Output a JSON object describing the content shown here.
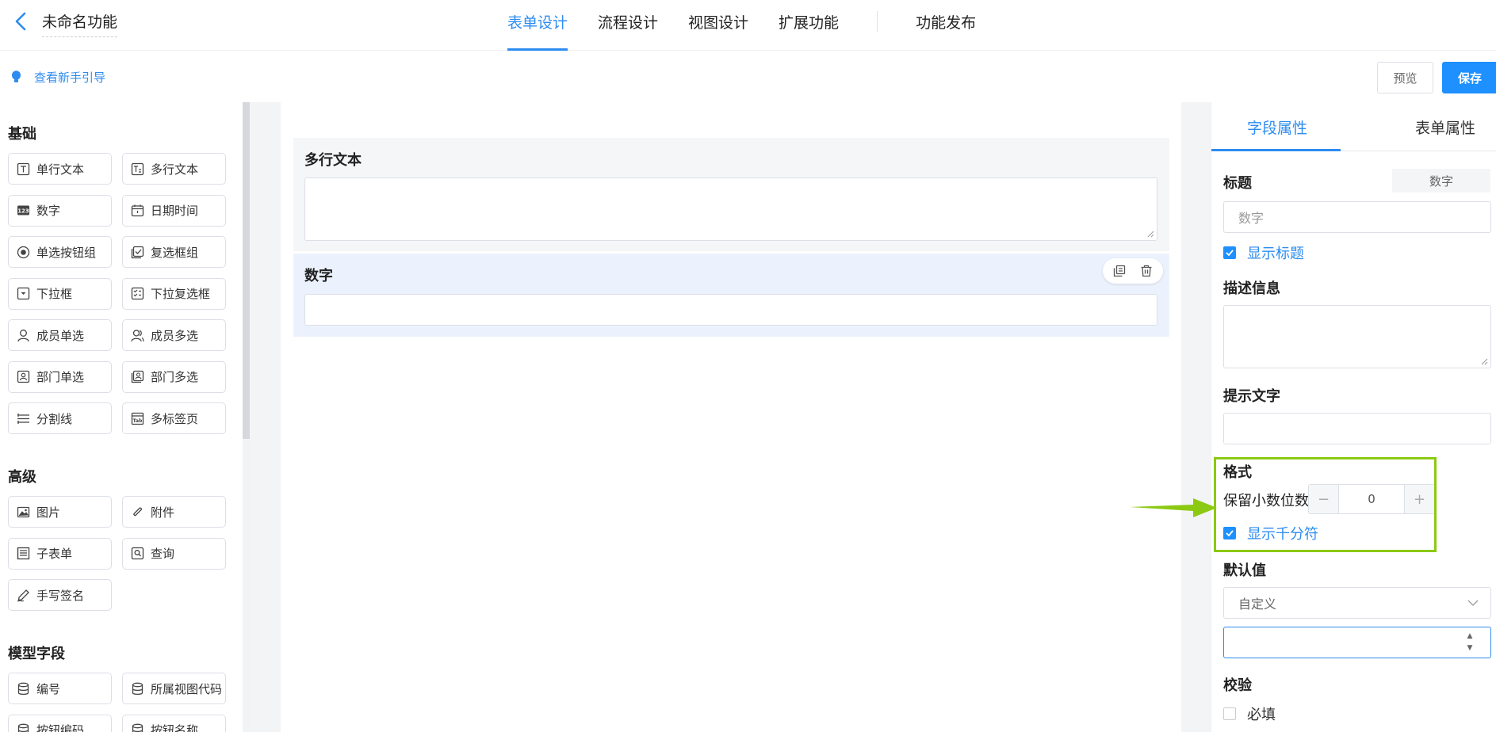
{
  "header": {
    "app_title": "未命名功能",
    "tabs": [
      {
        "label": "表单设计",
        "active": true
      },
      {
        "label": "流程设计",
        "active": false
      },
      {
        "label": "视图设计",
        "active": false
      },
      {
        "label": "扩展功能",
        "active": false
      },
      {
        "label": "功能发布",
        "active": false
      }
    ]
  },
  "subbar": {
    "guide_label": "查看新手引导",
    "preview_label": "预览",
    "save_label": "保存"
  },
  "palette": {
    "groups": [
      {
        "title": "基础",
        "items": [
          {
            "label": "单行文本",
            "icon": "single-line-text-icon"
          },
          {
            "label": "多行文本",
            "icon": "multi-line-text-icon"
          },
          {
            "label": "数字",
            "icon": "number-icon"
          },
          {
            "label": "日期时间",
            "icon": "calendar-icon"
          },
          {
            "label": "单选按钮组",
            "icon": "radio-icon"
          },
          {
            "label": "复选框组",
            "icon": "checkbox-icon"
          },
          {
            "label": "下拉框",
            "icon": "dropdown-icon"
          },
          {
            "label": "下拉复选框",
            "icon": "dropdown-checkbox-icon"
          },
          {
            "label": "成员单选",
            "icon": "user-icon"
          },
          {
            "label": "成员多选",
            "icon": "users-icon"
          },
          {
            "label": "部门单选",
            "icon": "department-icon"
          },
          {
            "label": "部门多选",
            "icon": "departments-icon"
          },
          {
            "label": "分割线",
            "icon": "divider-icon"
          },
          {
            "label": "多标签页",
            "icon": "tabs-icon"
          }
        ]
      },
      {
        "title": "高级",
        "items": [
          {
            "label": "图片",
            "icon": "image-icon"
          },
          {
            "label": "附件",
            "icon": "paperclip-icon"
          },
          {
            "label": "子表单",
            "icon": "subform-icon"
          },
          {
            "label": "查询",
            "icon": "query-icon"
          },
          {
            "label": "手写签名",
            "icon": "signature-icon"
          }
        ]
      },
      {
        "title": "模型字段",
        "items": [
          {
            "label": "编号",
            "icon": "database-icon"
          },
          {
            "label": "所属视图代码",
            "icon": "database-icon"
          },
          {
            "label": "按钮编码",
            "icon": "database-icon"
          },
          {
            "label": "按钮名称",
            "icon": "database-icon"
          }
        ]
      }
    ]
  },
  "canvas": {
    "fields": [
      {
        "label": "多行文本",
        "type": "textarea",
        "selected": false
      },
      {
        "label": "数字",
        "type": "number",
        "selected": true
      }
    ]
  },
  "properties": {
    "tabs": [
      {
        "label": "字段属性",
        "active": true
      },
      {
        "label": "表单属性",
        "active": false
      }
    ],
    "title_label": "标题",
    "type_badge": "数字",
    "title_value": "数字",
    "show_title_label": "显示标题",
    "show_title_checked": true,
    "description_label": "描述信息",
    "hint_label": "提示文字",
    "format_label": "格式",
    "decimal_label": "保留小数位数",
    "decimal_value": "0",
    "minus": "−",
    "plus": "+",
    "thousands_label": "显示千分符",
    "thousands_checked": true,
    "default_label": "默认值",
    "default_mode": "自定义",
    "validation_label": "校验",
    "required_label": "必填",
    "required_checked": false,
    "highlight_color": "#8cc912",
    "accent_color": "#2d8cf0"
  }
}
